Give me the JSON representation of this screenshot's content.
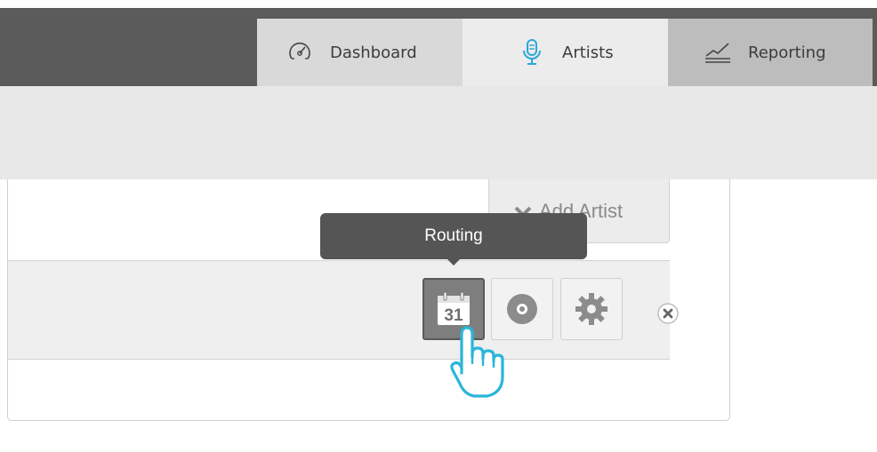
{
  "nav": {
    "tabs": [
      {
        "label": "Dashboard",
        "icon": "speedometer-icon"
      },
      {
        "label": "Artists",
        "icon": "microphone-icon",
        "active": true
      },
      {
        "label": "Reporting",
        "icon": "line-chart-icon"
      }
    ]
  },
  "toolbar": {
    "add_artist_label": "Add Artist"
  },
  "artist_row": {
    "actions": [
      {
        "name": "Routing",
        "icon": "calendar-icon",
        "calendar_day": "31",
        "active": true
      },
      {
        "name": "Record",
        "icon": "record-disc-icon"
      },
      {
        "name": "Settings",
        "icon": "gear-icon"
      }
    ],
    "tooltip": "Routing"
  },
  "colors": {
    "topbar": "#5b5b5b",
    "accent_blue": "#2aa8d8",
    "cursor_stroke": "#29b6d9",
    "tooltip_bg": "#555555"
  }
}
